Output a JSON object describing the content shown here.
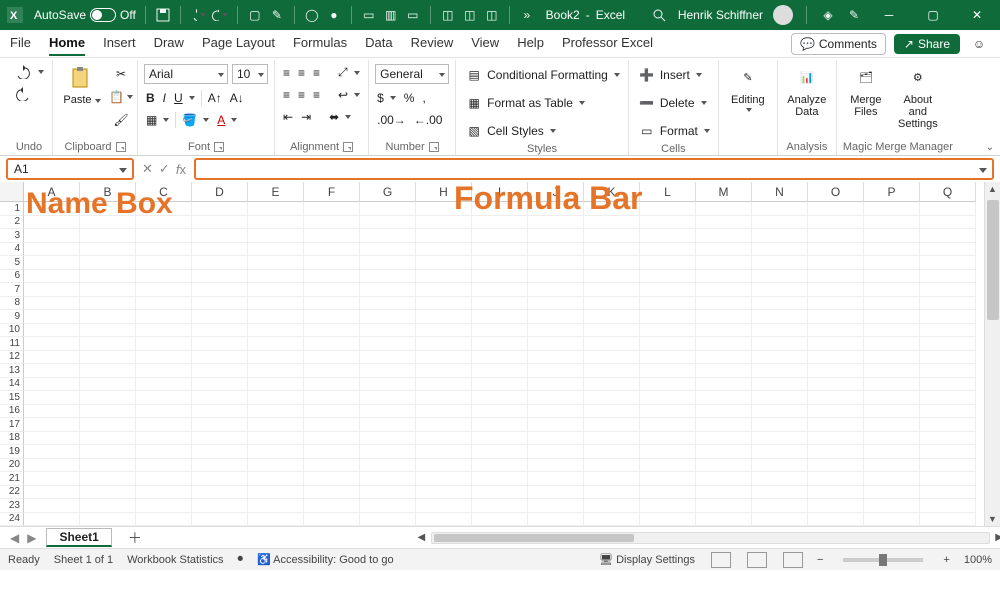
{
  "titlebar": {
    "autosave_label": "AutoSave",
    "autosave_state": "Off",
    "doc_name": "Book2",
    "app_name": "Excel",
    "user_name": "Henrik Schiffner"
  },
  "tabs": [
    "File",
    "Home",
    "Insert",
    "Draw",
    "Page Layout",
    "Formulas",
    "Data",
    "Review",
    "View",
    "Help",
    "Professor Excel"
  ],
  "active_tab": "Home",
  "top_right": {
    "comments": "Comments",
    "share": "Share"
  },
  "ribbon": {
    "undo_group": "Undo",
    "clipboard": {
      "paste": "Paste",
      "group": "Clipboard"
    },
    "font": {
      "name": "Arial",
      "size": "10",
      "group": "Font"
    },
    "alignment": {
      "group": "Alignment"
    },
    "number": {
      "format": "General",
      "group": "Number"
    },
    "styles": {
      "cond": "Conditional Formatting",
      "table": "Format as Table",
      "cell": "Cell Styles",
      "group": "Styles"
    },
    "cells": {
      "insert": "Insert",
      "delete": "Delete",
      "format": "Format",
      "group": "Cells"
    },
    "editing": {
      "label": "Editing"
    },
    "analysis": {
      "analyze": "Analyze Data",
      "group": "Analysis"
    },
    "merge_mgr": {
      "merge": "Merge Files",
      "about": "About and Settings",
      "group": "Magic Merge Manager"
    }
  },
  "formula_bar": {
    "name_box_value": "A1",
    "annot_namebox": "Name Box",
    "annot_formula": "Formula Bar"
  },
  "columns": [
    "A",
    "B",
    "C",
    "D",
    "E",
    "F",
    "G",
    "H",
    "I",
    "J",
    "K",
    "L",
    "M",
    "N",
    "O",
    "P",
    "Q"
  ],
  "rows": 24,
  "sheet_tab": "Sheet1",
  "statusbar": {
    "ready": "Ready",
    "sheet_count": "Sheet 1 of 1",
    "wb_stats": "Workbook Statistics",
    "accessibility": "Accessibility: Good to go",
    "display": "Display Settings",
    "zoom": "100%"
  }
}
